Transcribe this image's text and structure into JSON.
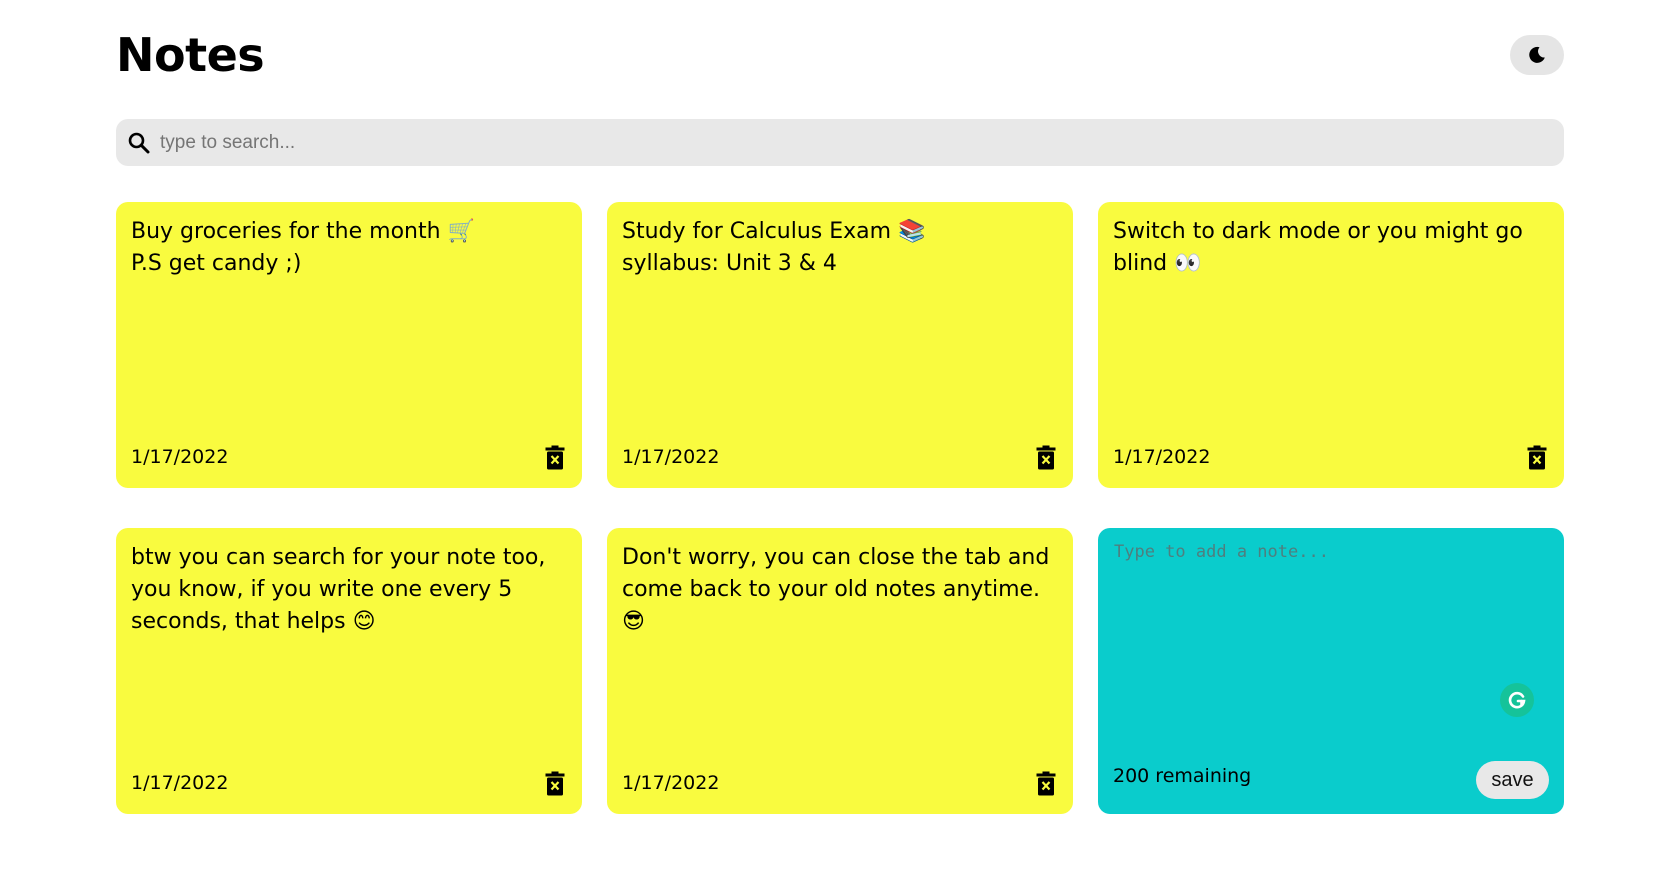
{
  "header": {
    "title": "Notes",
    "theme_toggle_icon": "moon-icon"
  },
  "search": {
    "placeholder": "type to search...",
    "value": "",
    "icon": "search-icon"
  },
  "notes": [
    {
      "text": "Buy groceries for the month 🛒\nP.S get candy ;)",
      "date": "1/17/2022",
      "delete_icon": "trash-icon"
    },
    {
      "text": "Study for Calculus Exam 📚\nsyllabus: Unit 3 & 4",
      "date": "1/17/2022",
      "delete_icon": "trash-icon"
    },
    {
      "text": "Switch to dark mode or you might go blind 👀",
      "date": "1/17/2022",
      "delete_icon": "trash-icon"
    },
    {
      "text": "btw you can search for your note too, you know, if you write one every 5 seconds, that helps 😊",
      "date": "1/17/2022",
      "delete_icon": "trash-icon"
    },
    {
      "text": "Don't worry, you can close the tab and come back to your old notes anytime.😎",
      "date": "1/17/2022",
      "delete_icon": "trash-icon"
    }
  ],
  "new_note": {
    "placeholder": "Type to add a note...",
    "value": "",
    "remaining_label": "200 remaining",
    "save_label": "save",
    "grammarly_icon": "grammarly-icon"
  },
  "colors": {
    "note_background": "#f9fb3f",
    "new_note_background": "#0acccc",
    "search_background": "#e8e8e8",
    "toggle_background": "#e5e5e5"
  }
}
